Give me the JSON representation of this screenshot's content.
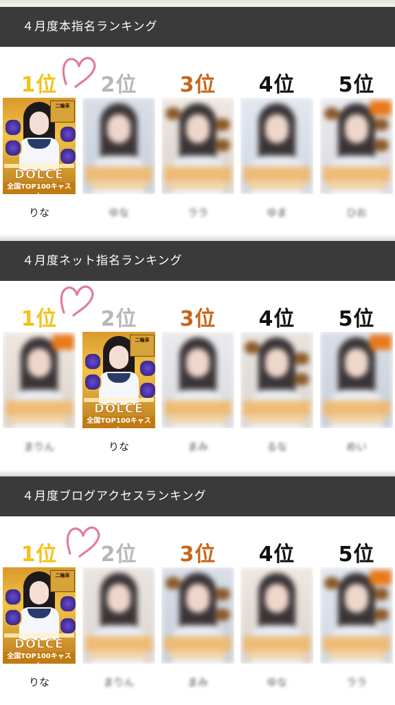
{
  "sections": [
    {
      "title": "４月度本指名ランキング",
      "ranks": [
        "1位",
        "2位",
        "3位",
        "4位",
        "5位"
      ],
      "cards": [
        {
          "name": "りな",
          "featured": true,
          "logo": "DOLCE",
          "badge": "二輪車",
          "sub": "全国TOP100キャスト"
        },
        {
          "name": "ゆな",
          "featured": false
        },
        {
          "name": "ララ",
          "featured": false
        },
        {
          "name": "ゆま",
          "featured": false
        },
        {
          "name": "ひお",
          "featured": false
        }
      ]
    },
    {
      "title": "４月度ネット指名ランキング",
      "ranks": [
        "1位",
        "2位",
        "3位",
        "4位",
        "5位"
      ],
      "cards": [
        {
          "name": "まりん",
          "featured": false
        },
        {
          "name": "りな",
          "featured": true,
          "logo": "DOLCE",
          "badge": "二輪車",
          "sub": "全国TOP100キャスト"
        },
        {
          "name": "まみ",
          "featured": false
        },
        {
          "name": "るな",
          "featured": false
        },
        {
          "name": "めい",
          "featured": false
        }
      ]
    },
    {
      "title": "４月度ブログアクセスランキング",
      "ranks": [
        "1位",
        "2位",
        "3位",
        "4位",
        "5位"
      ],
      "cards": [
        {
          "name": "りな",
          "featured": true,
          "logo": "DOLCE",
          "badge": "二輪車",
          "sub": "全国TOP100キャスト"
        },
        {
          "name": "まりん",
          "featured": false
        },
        {
          "name": "まみ",
          "featured": false
        },
        {
          "name": "ゆな",
          "featured": false
        },
        {
          "name": "ララ",
          "featured": false
        }
      ]
    }
  ],
  "colors": {
    "header_bg": "#3a3a3a",
    "rank1": "#f2c21d",
    "rank2": "#b7b7b7",
    "rank3": "#c8651a",
    "rank4": "#111111",
    "rank5": "#111111",
    "heart": "#e07a9e"
  },
  "icons": {
    "heart": "heart-icon"
  }
}
